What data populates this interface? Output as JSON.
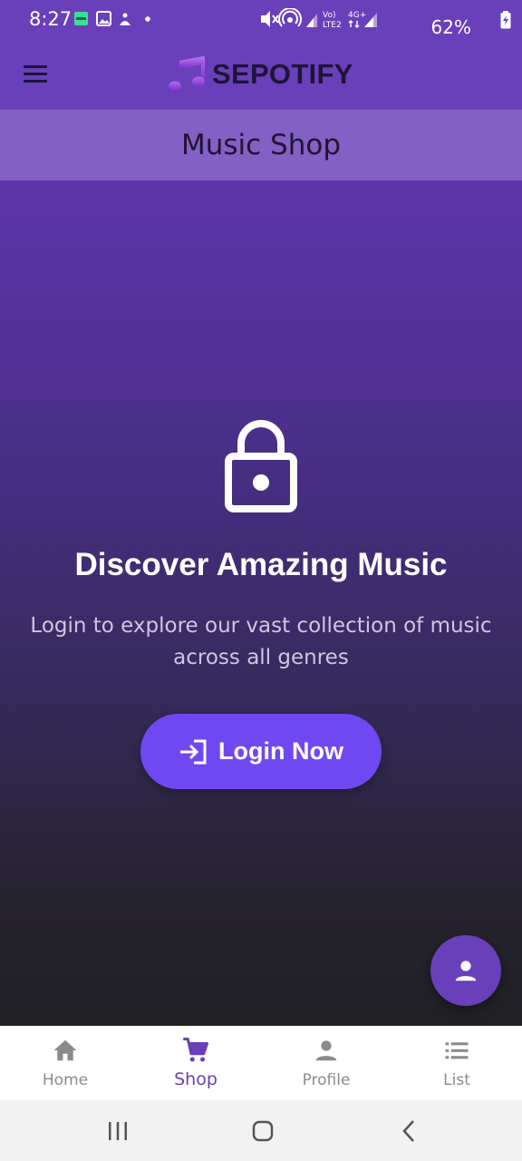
{
  "status_bar": {
    "time": "8:27",
    "battery": "62%",
    "left_icons": [
      "notification-badge-icon",
      "gallery-icon",
      "app-notification-icon",
      "dot-icon"
    ],
    "right_icons": [
      "mute-icon",
      "hotspot-icon",
      "signal-icon",
      "volte-icon",
      "4g-icon",
      "signal-icon",
      "battery-charging-icon"
    ],
    "volte_text_top": "Vo)",
    "volte_text_bottom": "LTE2",
    "network_text": "4G+"
  },
  "app_bar": {
    "brand_emoji": "🎵",
    "brand_title": "SEPOTIFY"
  },
  "page_header": {
    "title": "Music Shop"
  },
  "main": {
    "heading": "Discover Amazing Music",
    "description": "Login to explore our vast collection of music across all genres",
    "login_button_label": "Login Now"
  },
  "bottom_nav": {
    "items": [
      {
        "label": "Home",
        "icon": "home-icon",
        "active": false
      },
      {
        "label": "Shop",
        "icon": "cart-icon",
        "active": true
      },
      {
        "label": "Profile",
        "icon": "person-icon",
        "active": false
      },
      {
        "label": "List",
        "icon": "list-icon",
        "active": false
      }
    ]
  },
  "colors": {
    "primary": "#6a3fba",
    "button": "#7048f2",
    "active_nav": "#6a3fba",
    "inactive_nav": "#8b8b8b"
  }
}
